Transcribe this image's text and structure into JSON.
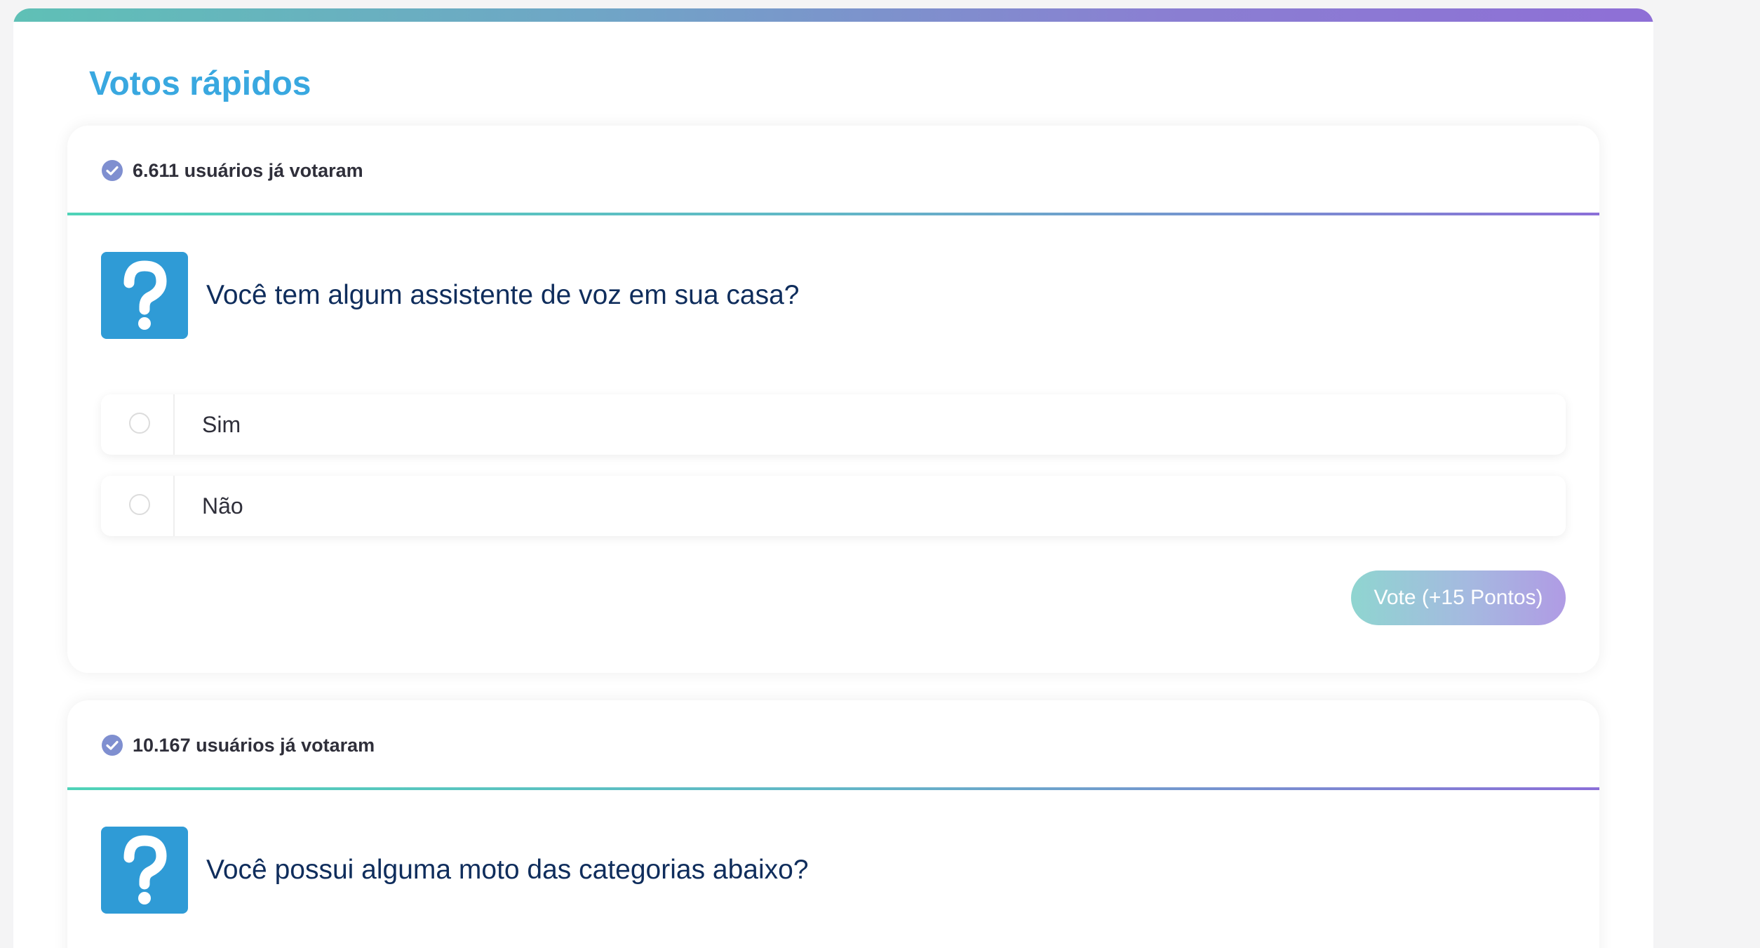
{
  "section": {
    "title": "Votos rápidos"
  },
  "polls": [
    {
      "voters": "6.611 usuários já votaram",
      "question": "Você tem algum assistente de voz em sua casa?",
      "options": [
        "Sim",
        "Não"
      ],
      "vote_button": "Vote (+15 Pontos)"
    },
    {
      "voters": "10.167 usuários já votaram",
      "question": "Você possui alguma moto das categorias abaixo?"
    }
  ],
  "colors": {
    "title": "#39a8e0",
    "question_icon": "#2f9bd6",
    "check_icon": "#7f8fd0",
    "question_text": "#0f2d5c",
    "accent_gradient": [
      "#4fd3b8",
      "#8b6fd8"
    ]
  },
  "icons": {
    "voters": "check-circle-icon",
    "question": "question-mark-icon",
    "option": "radio-unchecked-icon"
  }
}
